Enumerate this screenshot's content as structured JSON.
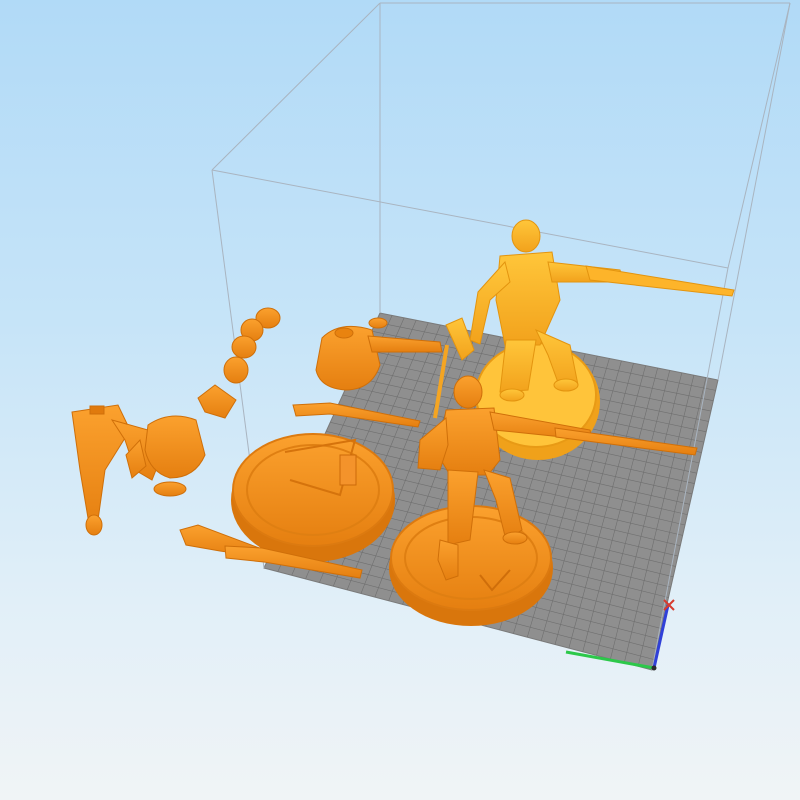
{
  "viewport": {
    "background_top": "#b1daf7",
    "background_bottom": "#f0f4f6"
  },
  "build_plate": {
    "color": "#8f8f8f",
    "grid_color": "#6e6e6e"
  },
  "model": {
    "color": "#f5901c",
    "selected_color": "#fdb42a",
    "parts": [
      "figure-shotgun-standing",
      "figure-chainsaw-standing",
      "round-base-large",
      "round-base-front",
      "round-base-left",
      "torso-arm",
      "legs-pair",
      "torso-armored",
      "heads-set",
      "rifle-1",
      "rifle-2",
      "hand-rifle"
    ]
  },
  "axes": {
    "x_color": "#d63b2f",
    "y_color": "#2cc84a",
    "z_color": "#3040d8"
  }
}
